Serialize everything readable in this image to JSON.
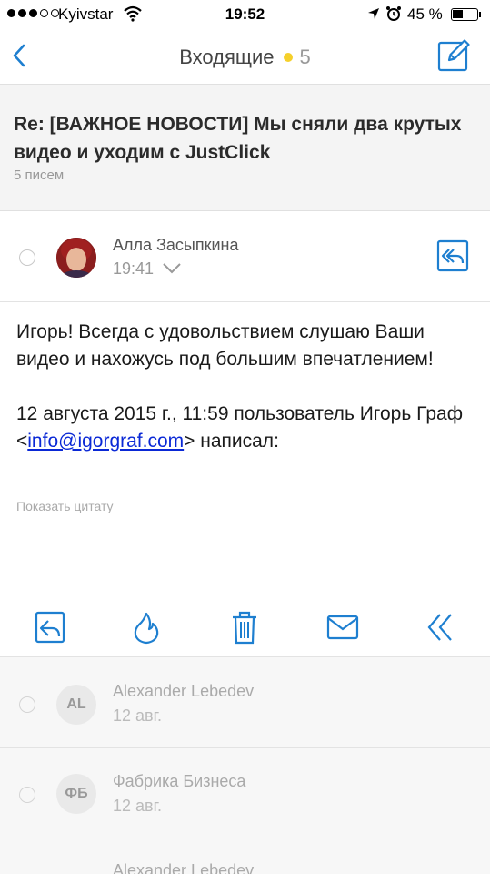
{
  "status_bar": {
    "carrier": "Kyivstar",
    "time": "19:52",
    "battery": "45 %",
    "battery_level": 0.45
  },
  "nav": {
    "title": "Входящие",
    "unread_count": "5"
  },
  "thread": {
    "subject": "Re: [ВАЖНОЕ НОВОСТИ] Мы сняли два крутых видео и уходим с JustClick",
    "message_count": "5 писем"
  },
  "message": {
    "sender": "Алла Засыпкина",
    "time": "19:41",
    "body_line1": "Игорь! Всегда с удовольствием слушаю Ваши видео и нахожусь под большим впечатлением!",
    "quote_prefix": "12 августа 2015 г., 11:59 пользователь Игорь Граф <",
    "quote_email": "info@igorgraf.com",
    "quote_suffix": "> написал:",
    "show_quote": "Показать цитату"
  },
  "list": [
    {
      "initials": "AL",
      "name": "Alexander Lebedev",
      "date": "12 авг."
    },
    {
      "initials": "ФБ",
      "name": "Фабрика Бизнеса",
      "date": "12 авг."
    },
    {
      "initials": "",
      "name": "Alexander Lebedev",
      "date": ""
    }
  ],
  "colors": {
    "accent": "#1e7fd0",
    "unread_dot": "#f5d02b",
    "link": "#0a28d6"
  }
}
